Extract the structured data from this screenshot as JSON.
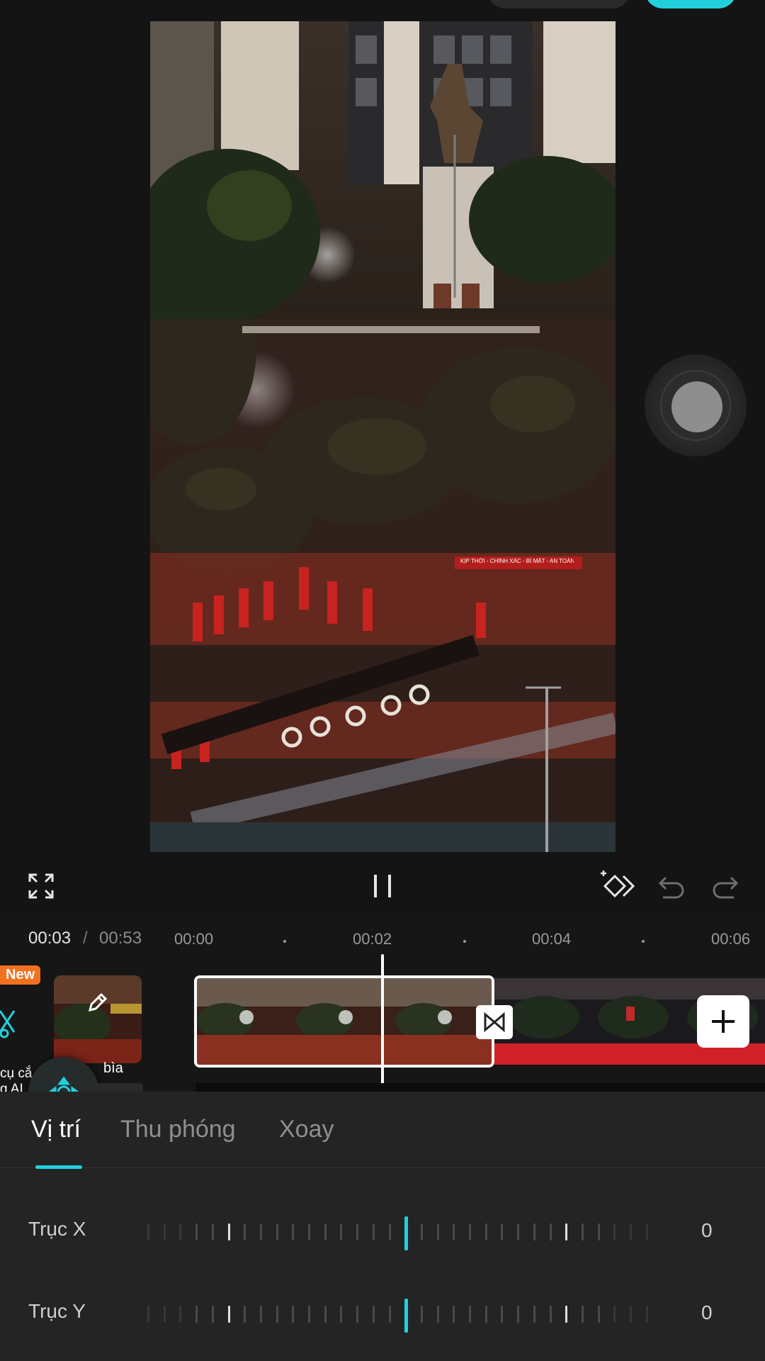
{
  "preview": {
    "banner_text": "KỊP THỜI - CHÍNH XÁC - BÍ MẬT - AN TOÀN"
  },
  "timeline": {
    "current_time": "00:03",
    "separator": "/",
    "total_time": "00:53",
    "ticks": [
      "00:00",
      "00:02",
      "00:04",
      "00:06"
    ],
    "new_badge": "New",
    "ai_tool_label_line1": "cụ cắ",
    "ai_tool_label_line2": "g AI",
    "cover_label": "bìa"
  },
  "panel": {
    "tabs": [
      "Vị trí",
      "Thu phóng",
      "Xoay"
    ],
    "active_tab": 0,
    "sliders": [
      {
        "label": "Trục X",
        "value": "0"
      },
      {
        "label": "Trục Y",
        "value": "0"
      }
    ]
  },
  "colors": {
    "accent": "#22d0dc",
    "badge": "#f3701f",
    "background": "#141414",
    "panel": "#242424"
  }
}
